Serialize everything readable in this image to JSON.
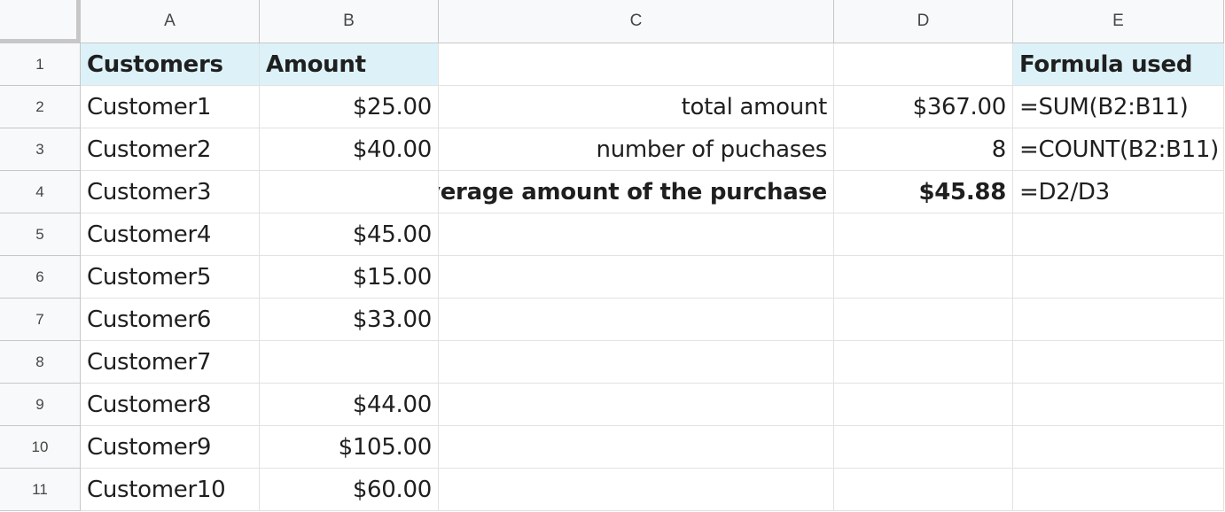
{
  "columns": [
    "A",
    "B",
    "C",
    "D",
    "E"
  ],
  "rows": [
    {
      "num": "1",
      "A": "Customers",
      "B": "Amount",
      "C": "",
      "D": "",
      "E": "Formula used"
    },
    {
      "num": "2",
      "A": "Customer1",
      "B": "$25.00",
      "C": "total amount",
      "D": "$367.00",
      "E": "=SUM(B2:B11)"
    },
    {
      "num": "3",
      "A": "Customer2",
      "B": "$40.00",
      "C": "number of puchases",
      "D": "8",
      "E": "=COUNT(B2:B11)"
    },
    {
      "num": "4",
      "A": "Customer3",
      "B": "",
      "C": "average amount of the purchase",
      "D": "$45.88",
      "E": "=D2/D3"
    },
    {
      "num": "5",
      "A": "Customer4",
      "B": "$45.00",
      "C": "",
      "D": "",
      "E": ""
    },
    {
      "num": "6",
      "A": "Customer5",
      "B": "$15.00",
      "C": "",
      "D": "",
      "E": ""
    },
    {
      "num": "7",
      "A": "Customer6",
      "B": "$33.00",
      "C": "",
      "D": "",
      "E": ""
    },
    {
      "num": "8",
      "A": "Customer7",
      "B": "",
      "C": "",
      "D": "",
      "E": ""
    },
    {
      "num": "9",
      "A": "Customer8",
      "B": "$44.00",
      "C": "",
      "D": "",
      "E": ""
    },
    {
      "num": "10",
      "A": "Customer9",
      "B": "$105.00",
      "C": "",
      "D": "",
      "E": ""
    },
    {
      "num": "11",
      "A": "Customer10",
      "B": "$60.00",
      "C": "",
      "D": "",
      "E": ""
    }
  ],
  "colors": {
    "header_fill": "#ddf2f8",
    "gridline": "#e2e2e2",
    "header_bg": "#f8f9fa"
  }
}
